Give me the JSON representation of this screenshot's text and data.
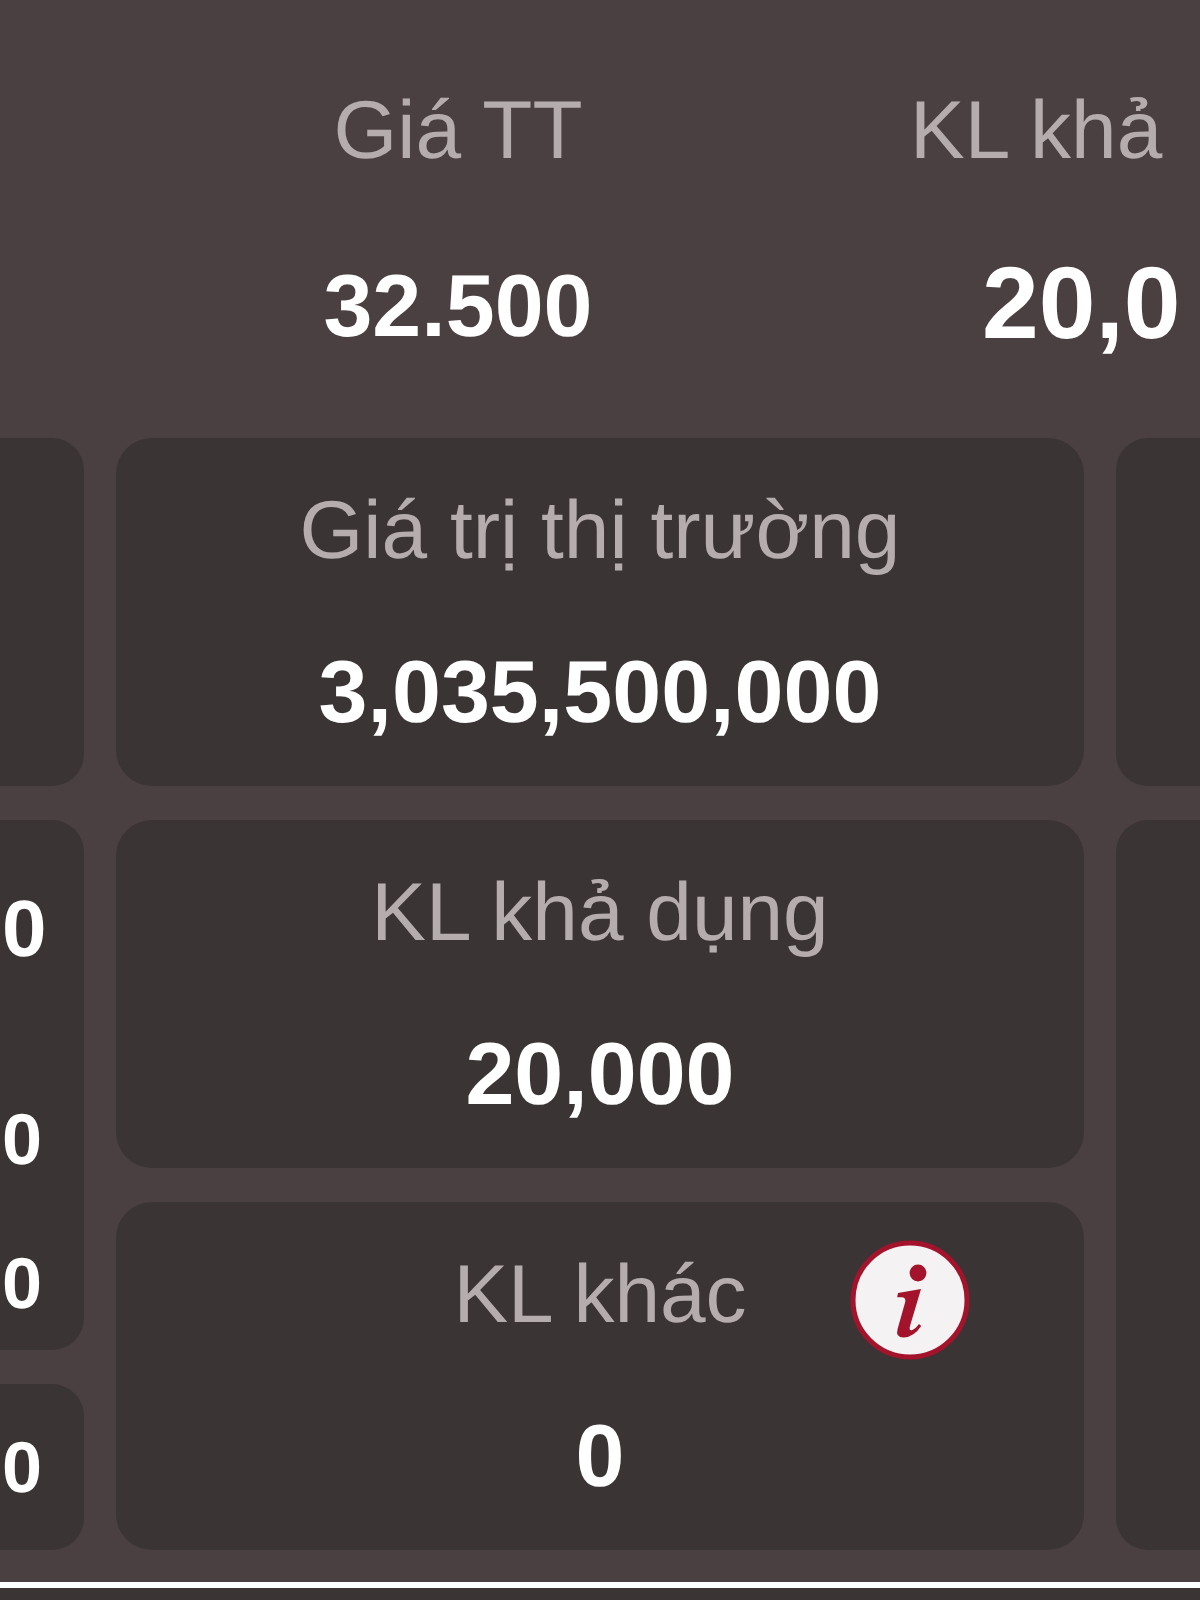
{
  "header": [
    {
      "label": "Giá TT",
      "value": "32.500"
    },
    {
      "label": "KL khả",
      "value": "20,0"
    }
  ],
  "left_cards": [
    {
      "kind": "blank"
    },
    {
      "kind": "values",
      "values": [
        "0",
        "0",
        "0"
      ]
    },
    {
      "kind": "values",
      "values": [
        "0"
      ]
    }
  ],
  "center_cards": [
    {
      "label": "Giá trị thị trường",
      "value": "3,035,500,000",
      "has_info": false
    },
    {
      "label": "KL khả dụng",
      "value": "20,000",
      "has_info": false
    },
    {
      "label": "KL khác",
      "value": "0",
      "has_info": true
    }
  ],
  "right_cards": [
    {
      "kind": "blank"
    },
    {
      "kind": "blank"
    }
  ]
}
